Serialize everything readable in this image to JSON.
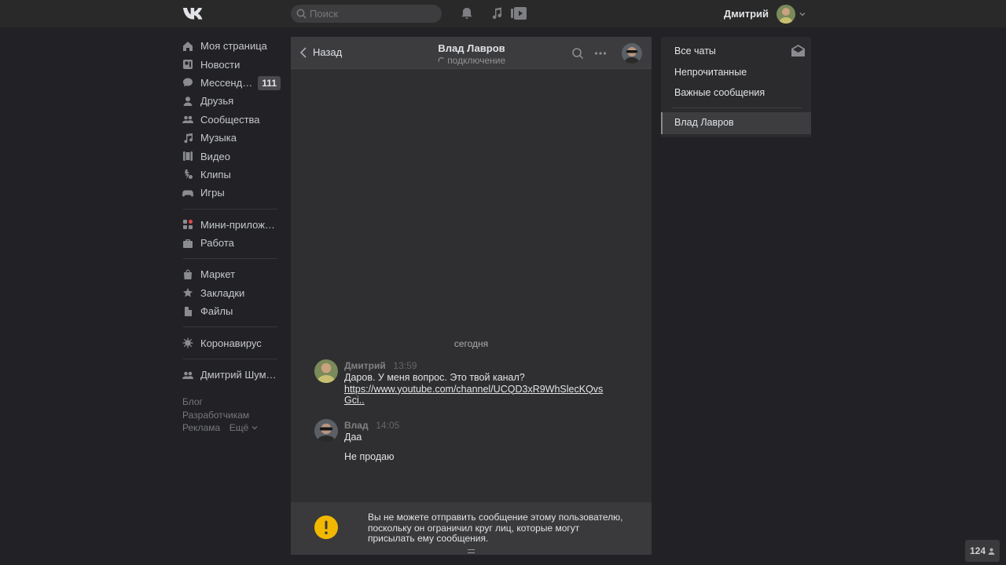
{
  "header": {
    "search_placeholder": "Поиск",
    "user_name": "Дмитрий",
    "icons": [
      "vk-logo-icon",
      "bell-icon",
      "music-note-icon",
      "video-play-icon",
      "chevron-down-icon"
    ]
  },
  "sidebar": {
    "groups": [
      [
        {
          "label": "Моя страница",
          "icon": "home-icon"
        },
        {
          "label": "Новости",
          "icon": "news-icon"
        },
        {
          "label": "Мессенджер",
          "icon": "messages-icon",
          "badge": "111"
        },
        {
          "label": "Друзья",
          "icon": "user-icon"
        },
        {
          "label": "Сообщества",
          "icon": "users-icon"
        },
        {
          "label": "Музыка",
          "icon": "music-note-icon"
        },
        {
          "label": "Видео",
          "icon": "film-icon"
        },
        {
          "label": "Клипы",
          "icon": "clips-icon"
        },
        {
          "label": "Игры",
          "icon": "gamepad-icon"
        }
      ],
      [
        {
          "label": "Мини-приложения",
          "icon": "apps-icon"
        },
        {
          "label": "Работа",
          "icon": "briefcase-icon"
        }
      ],
      [
        {
          "label": "Маркет",
          "icon": "bag-icon"
        },
        {
          "label": "Закладки",
          "icon": "star-icon"
        },
        {
          "label": "Файлы",
          "icon": "file-icon"
        }
      ],
      [
        {
          "label": "Коронавирус",
          "icon": "virus-icon"
        }
      ],
      [
        {
          "label": "Дмитрий Шумилов",
          "icon": "users-icon"
        }
      ]
    ],
    "footer": {
      "blog": "Блог",
      "developers": "Разработчикам",
      "ads": "Реклама",
      "more": "Ещё"
    }
  },
  "chat": {
    "back_label": "Назад",
    "peer_name": "Влад Лавров",
    "peer_status": "подключение",
    "day_label": "сегодня",
    "messages": [
      {
        "author": "Дмитрий",
        "time": "13:59",
        "lines": [
          "Даров. У меня вопрос. Это твой канал?"
        ],
        "link_line1": "https://www.youtube.com/channel/UCQD3xR9WhSlecKQvs",
        "link_line2": "Gci.."
      },
      {
        "author": "Влад",
        "time": "14:05",
        "lines": [
          "Даа",
          "Не продаю"
        ]
      }
    ],
    "warning_line1": "Вы не можете отправить сообщение этому пользователю,",
    "warning_line2": "поскольку он ограничил круг лиц, которые могут",
    "warning_line3": "присылать ему сообщения."
  },
  "filters": {
    "all": "Все чаты",
    "unread": "Непрочитанные",
    "important": "Важные сообщения",
    "active_chat": "Влад Лавров"
  },
  "online_count": "124",
  "colors": {
    "background": "#222226",
    "header": "#292929",
    "panel": "#2f2f31",
    "warning": "#f2b800"
  }
}
